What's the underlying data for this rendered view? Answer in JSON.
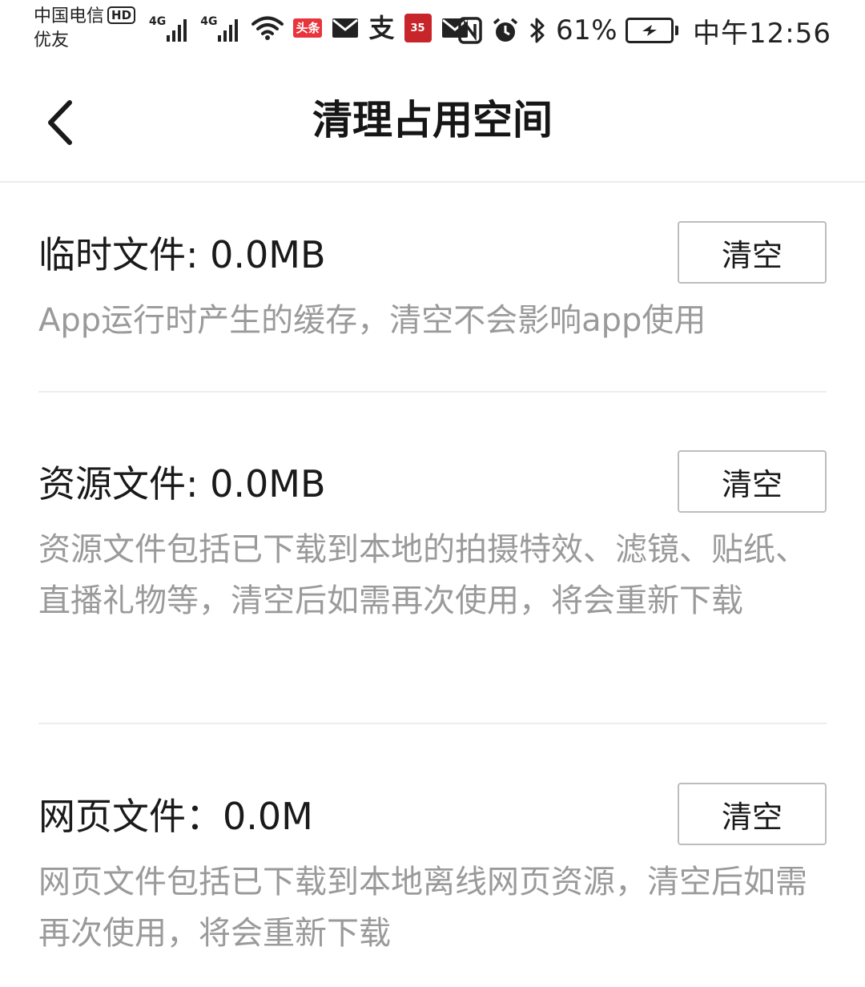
{
  "status_bar": {
    "carrier_line1": "中国电信",
    "hd_badge": "HD",
    "carrier_line2": "优友",
    "network_1": "4G",
    "network_2": "4G",
    "toutiao_badge": "头条",
    "alipay_glyph": "支",
    "app_badge": "35",
    "battery_percent": "61%",
    "time": "中午12:56",
    "icons": [
      "signal-icon",
      "signal-icon",
      "wifi-icon",
      "toutiao-icon",
      "mail-icon",
      "alipay-icon",
      "app-badge-icon",
      "mail-icon",
      "nfc-icon",
      "alarm-icon",
      "bluetooth-icon",
      "battery-charging-icon"
    ]
  },
  "header": {
    "title": "清理占用空间",
    "back_icon": "chevron-left-icon"
  },
  "sections": [
    {
      "title": "临时文件: 0.0MB",
      "button": "清空",
      "description": "App运行时产生的缓存，清空不会影响app使用"
    },
    {
      "title": "资源文件: 0.0MB",
      "button": "清空",
      "description": "资源文件包括已下载到本地的拍摄特效、滤镜、贴纸、直播礼物等，清空后如需再次使用，将会重新下载"
    },
    {
      "title": "网页文件：0.0M",
      "button": "清空",
      "description": "网页文件包括已下载到本地离线网页资源，清空后如需再次使用，将会重新下载"
    }
  ]
}
